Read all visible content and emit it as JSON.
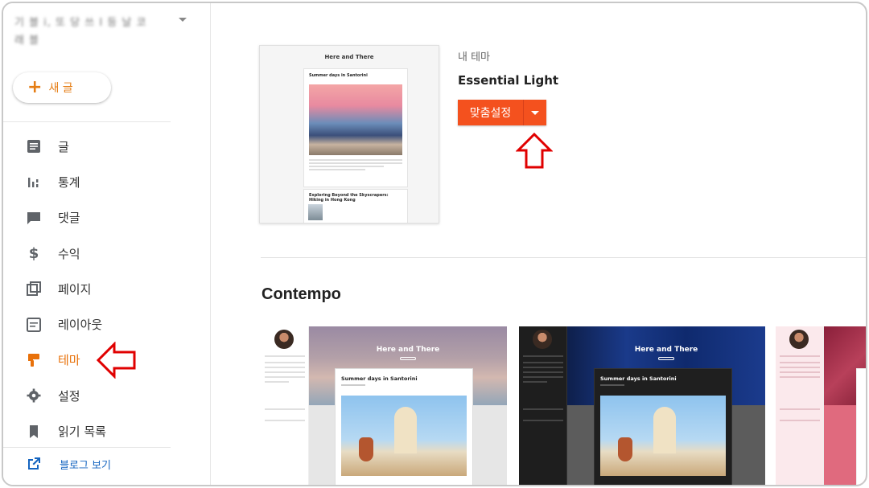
{
  "sidebar": {
    "blog_name_line1": "기 블 i, 또 당 쓰 Ⅰ 등 날 코",
    "blog_name_line2": "래 블",
    "new_post_label": "새 글",
    "nav": [
      {
        "label": "글",
        "icon": "posts-icon"
      },
      {
        "label": "통계",
        "icon": "stats-icon"
      },
      {
        "label": "댓글",
        "icon": "comments-icon"
      },
      {
        "label": "수익",
        "icon": "earnings-icon"
      },
      {
        "label": "페이지",
        "icon": "pages-icon"
      },
      {
        "label": "레이아웃",
        "icon": "layout-icon"
      },
      {
        "label": "테마",
        "icon": "theme-icon",
        "active": true
      },
      {
        "label": "설정",
        "icon": "settings-icon"
      },
      {
        "label": "읽기 목록",
        "icon": "reading-list-icon"
      }
    ],
    "view_blog_label": "블로그 보기"
  },
  "current_theme": {
    "section_label": "내 테마",
    "name": "Essential Light",
    "customize_label": "맞춤설정",
    "preview": {
      "blog_title": "Here and There",
      "post1_title": "Summer days in Santorini",
      "post2_title": "Exploring Beyond the Skyscrapers: Hiking in Hong Kong"
    }
  },
  "theme_gallery": {
    "section_title": "Contempo",
    "thumbnails": [
      {
        "blog_title": "Here and There",
        "post_title": "Summer days in Santorini",
        "variant": "light"
      },
      {
        "blog_title": "Here and There",
        "post_title": "Summer days in Santorini",
        "variant": "dark"
      },
      {
        "blog_title": "",
        "post_title": "",
        "variant": "pink"
      }
    ]
  },
  "colors": {
    "accent_orange": "#e8710a",
    "customize_button": "#f4511e",
    "annotation_arrow": "#e00000"
  }
}
